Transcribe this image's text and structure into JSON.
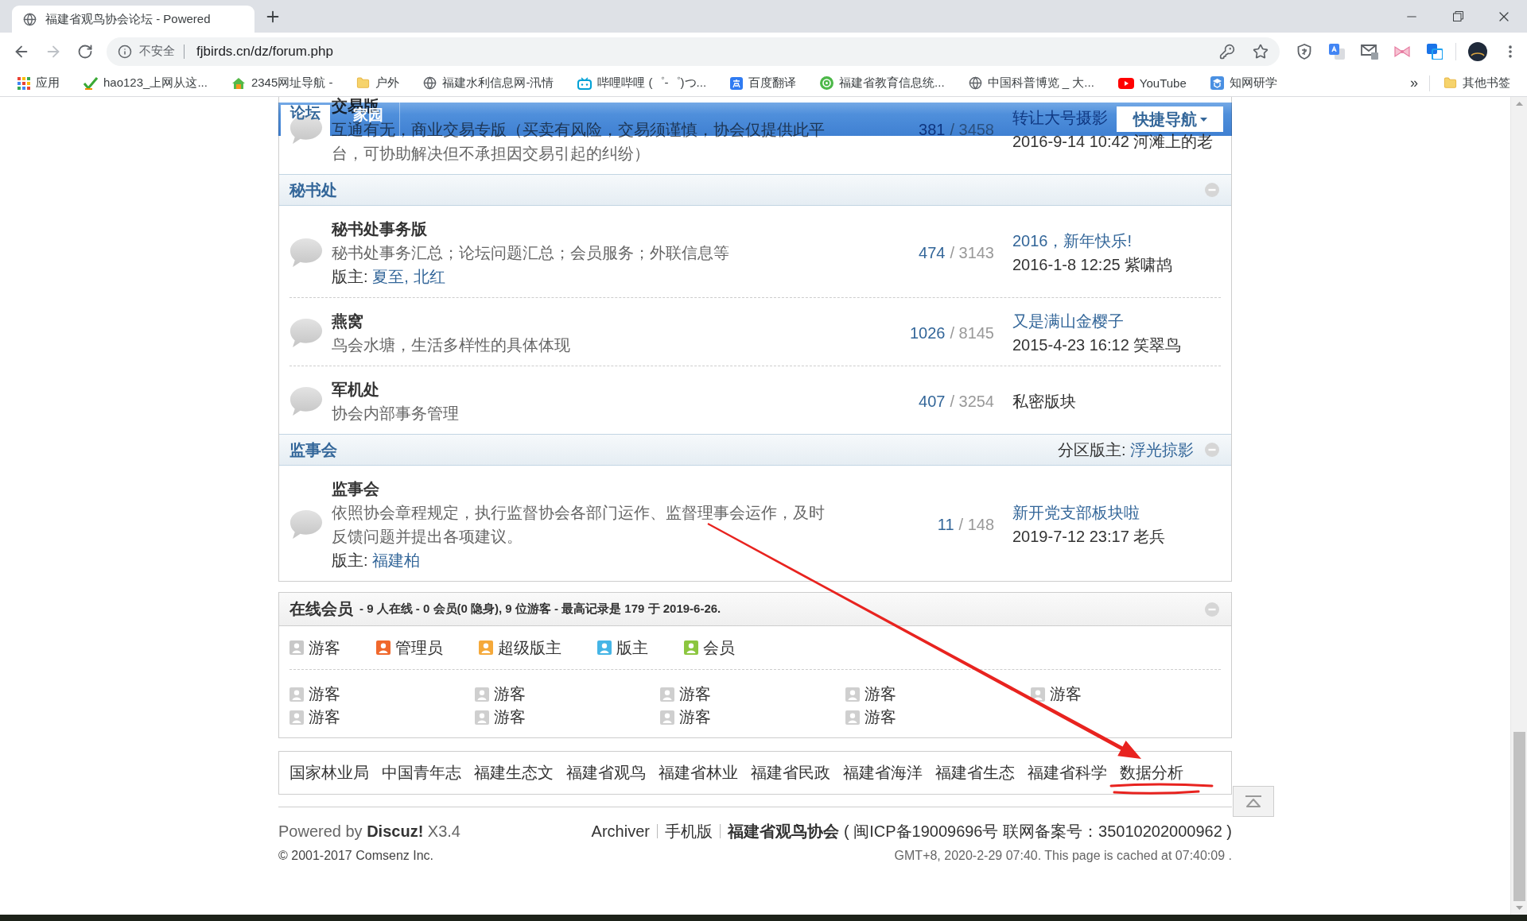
{
  "browser": {
    "tab_title": "福建省观鸟协会论坛 - Powered",
    "security_label": "不安全",
    "url": "fjbirds.cn/dz/forum.php",
    "bookmarks": [
      {
        "label": "应用",
        "kind": "apps"
      },
      {
        "label": "hao123_上网从这...",
        "kind": "check"
      },
      {
        "label": "2345网址导航 -",
        "kind": "house"
      },
      {
        "label": "户外",
        "kind": "folder"
      },
      {
        "label": "福建水利信息网-汛情",
        "kind": "globe"
      },
      {
        "label": "哔哩哔哩 (゜-゜)つ...",
        "kind": "tv"
      },
      {
        "label": "百度翻译",
        "kind": "translate"
      },
      {
        "label": "福建省教育信息统...",
        "kind": "circle"
      },
      {
        "label": "中国科普博览 _ 大...",
        "kind": "globe"
      },
      {
        "label": "YouTube",
        "kind": "play"
      },
      {
        "label": "知网研学",
        "kind": "book"
      }
    ],
    "bookmarks_more": "»",
    "other_bookmarks": "其他书签"
  },
  "nav": {
    "tabs": [
      {
        "label": "论坛",
        "selected": true
      },
      {
        "label": "家园",
        "selected": false
      }
    ],
    "quick_nav": "快捷导航"
  },
  "categories": [
    {
      "forums": [
        {
          "name": "交易版",
          "description": "互通有无，商业交易专版（买卖有风险，交易须谨慎，协会仅提供此平台，可协助解决但不承担因交易引起的纠纷）",
          "threads": "381",
          "posts": "/ 3458",
          "last_post": {
            "kind": "post",
            "title": "转让大号摄影",
            "meta": "2016-9-14 10:42 河滩上的老"
          }
        }
      ]
    },
    {
      "title": "秘书处",
      "forums": [
        {
          "name": "秘书处事务版",
          "description": "秘书处事务汇总；论坛问题汇总；会员服务；外联信息等",
          "moderators_label": "版主:",
          "moderators": [
            "夏至",
            "北红"
          ],
          "moderator_separator": ",",
          "threads": "474",
          "posts": "/ 3143",
          "last_post": {
            "kind": "post",
            "title": "2016，新年快乐!",
            "meta": "2016-1-8 12:25 紫啸鸪"
          }
        },
        {
          "name": "燕窝",
          "description": "鸟会水塘，生活多样性的具体体现",
          "threads": "1026",
          "posts": "/ 8145",
          "last_post": {
            "kind": "post",
            "title": "又是满山金樱子",
            "meta": "2015-4-23 16:12 笑翠鸟"
          }
        },
        {
          "name": "军机处",
          "description": "协会内部事务管理",
          "threads": "407",
          "posts": "/ 3254",
          "last_post": {
            "kind": "private",
            "text": "私密版块"
          }
        }
      ]
    },
    {
      "title": "监事会",
      "moderators_label": "分区版主:",
      "moderators": [
        "浮光掠影"
      ],
      "forums": [
        {
          "name": "监事会",
          "description": "依照协会章程规定，执行监督协会各部门运作、监督理事会运作，及时反馈问题并提出各项建议。",
          "moderators_label": "版主:",
          "moderators": [
            "福建柏"
          ],
          "threads": "11",
          "posts": "/ 148",
          "last_post": {
            "kind": "post",
            "title": "新开党支部板块啦",
            "meta": "2019-7-12 23:17 老兵"
          }
        }
      ]
    }
  ],
  "online": {
    "title": "在线会员",
    "summary": "- 9 人在线 - 0 会员(0 隐身), 9 位游客 - 最高记录是 179 于 2019-6-26.",
    "legend": [
      {
        "label": "游客",
        "color": "#c8c8c8"
      },
      {
        "label": "管理员",
        "color": "#f0682c"
      },
      {
        "label": "超级版主",
        "color": "#f5a93a"
      },
      {
        "label": "版主",
        "color": "#45b5e6"
      },
      {
        "label": "会员",
        "color": "#8cc63f"
      }
    ],
    "members": [
      "游客",
      "游客",
      "游客",
      "游客",
      "游客",
      "游客",
      "游客",
      "游客",
      "游客"
    ]
  },
  "friend_links": [
    "国家林业局",
    "中国青年志",
    "福建生态文",
    "福建省观鸟",
    "福建省林业",
    "福建省民政",
    "福建省海洋",
    "福建省生态",
    "福建省科学",
    "数据分析"
  ],
  "footer": {
    "powered": "Powered by **Discuz!** X3.4",
    "links": [
      "Archiver",
      "手机版"
    ],
    "site_name": "福建省观鸟协会",
    "registration": "( 闽ICP备19009696号 联网备案号：35010202000962 )",
    "copyright": "© 2001-2017 Comsenz Inc.",
    "server_time": "GMT+8, 2020-2-29 07:40. This page is cached at 07:40:09 ."
  },
  "annotations": {
    "arrow": true,
    "underline": true
  }
}
